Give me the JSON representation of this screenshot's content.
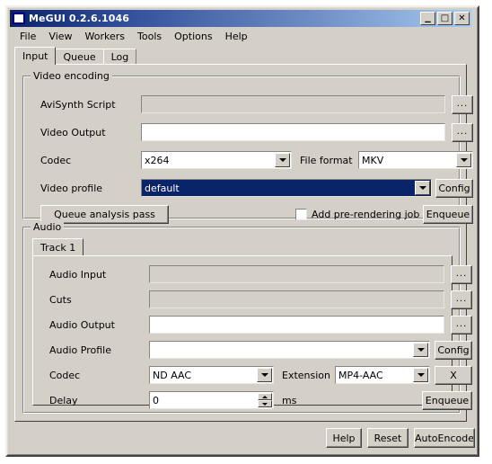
{
  "window": {
    "title": "MeGUI 0.2.6.1046",
    "icon": "window-icon",
    "minimize_label": "_",
    "maximize_label": "□",
    "close_label": "✕"
  },
  "menubar": {
    "items": [
      {
        "label": "File"
      },
      {
        "label": "View"
      },
      {
        "label": "Workers"
      },
      {
        "label": "Tools"
      },
      {
        "label": "Options"
      },
      {
        "label": "Help"
      }
    ]
  },
  "tabs": [
    {
      "label": "Input",
      "active": true
    },
    {
      "label": "Queue",
      "active": false
    },
    {
      "label": "Log",
      "active": false
    }
  ],
  "video_encoding": {
    "group_title": "Video encoding",
    "avisynth_script": {
      "label": "AviSynth Script",
      "value": "",
      "enabled": false,
      "browse_label": "..."
    },
    "video_output": {
      "label": "Video Output",
      "value": "",
      "enabled": true,
      "browse_label": "..."
    },
    "codec": {
      "label": "Codec",
      "value": "x264"
    },
    "file_format": {
      "label": "File format",
      "value": "MKV"
    },
    "video_profile": {
      "label": "Video profile",
      "value": "default",
      "selected": true,
      "config_label": "Config"
    },
    "queue_analysis_pass_label": "Queue analysis pass",
    "add_pre_rendering_job": {
      "label": "Add pre-rendering job",
      "checked": false
    },
    "enqueue_label": "Enqueue"
  },
  "audio": {
    "group_title": "Audio",
    "track_tabs": [
      {
        "label": "Track 1",
        "active": true
      }
    ],
    "audio_input": {
      "label": "Audio Input",
      "value": "",
      "enabled": false,
      "browse_label": "..."
    },
    "cuts": {
      "label": "Cuts",
      "value": "",
      "enabled": false,
      "browse_label": "..."
    },
    "audio_output": {
      "label": "Audio Output",
      "value": "",
      "enabled": true,
      "browse_label": "..."
    },
    "audio_profile": {
      "label": "Audio Profile",
      "value": "",
      "config_label": "Config"
    },
    "codec": {
      "label": "Codec",
      "value": "ND AAC"
    },
    "extension": {
      "label": "Extension",
      "value": "MP4-AAC"
    },
    "remove_label": "X",
    "delay": {
      "label": "Delay",
      "value": "0",
      "unit": "ms"
    },
    "enqueue_label": "Enqueue"
  },
  "footer": {
    "help_label": "Help",
    "reset_label": "Reset",
    "autoencode_label": "AutoEncode"
  },
  "colors": {
    "face": "#d4d0c8",
    "title_gradient_start": "#0a246a",
    "title_gradient_end": "#a6caf0",
    "selection": "#0a246a",
    "text": "#000000",
    "disabled_text": "#808080"
  }
}
